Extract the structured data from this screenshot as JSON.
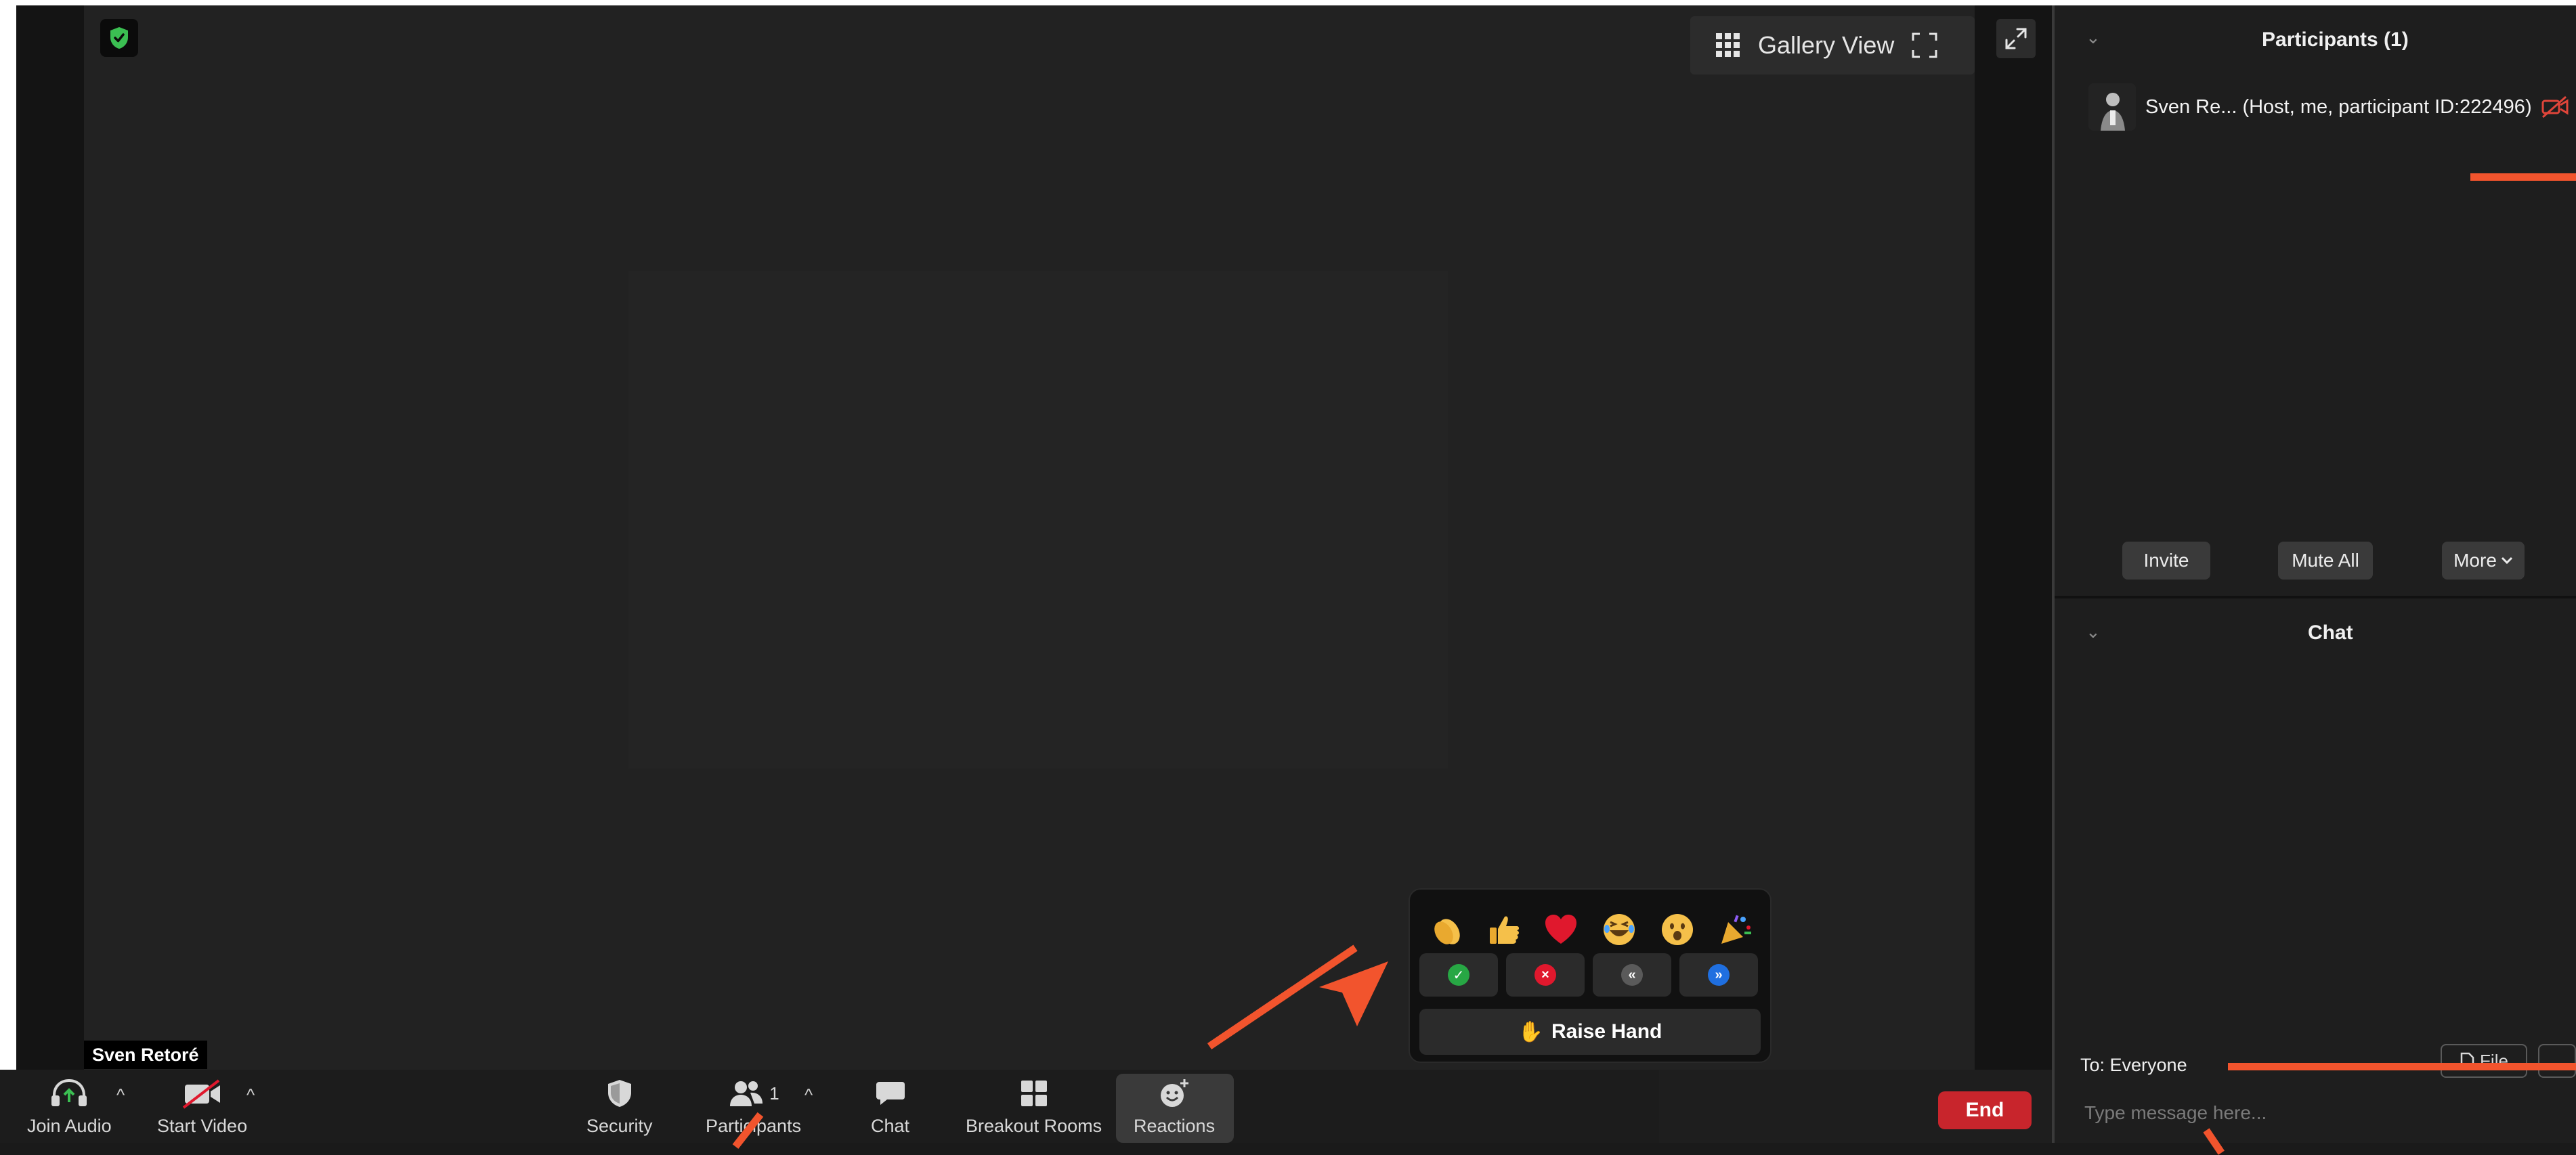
{
  "window": {
    "participant_name_tag": "Sven Retoré",
    "gallery_view_label": "Gallery View"
  },
  "toolbar": {
    "join_audio": "Join Audio",
    "start_video": "Start Video",
    "security": "Security",
    "participants": "Participants",
    "participants_count": "1",
    "chat": "Chat",
    "breakout_rooms": "Breakout Rooms",
    "reactions": "Reactions",
    "end": "End"
  },
  "reactions_popup": {
    "emojis": [
      "👏",
      "👍",
      "❤️",
      "😂",
      "😮",
      "🎉"
    ],
    "raise_hand_emoji": "✋",
    "raise_hand_label": "Raise Hand"
  },
  "participants_panel": {
    "title": "Participants (1)",
    "participant": "Sven Re... (Host, me, participant ID:222496)",
    "invite": "Invite",
    "mute_all": "Mute All",
    "more": "More"
  },
  "chat_panel": {
    "title": "Chat",
    "to": "To: Everyone",
    "file": "File",
    "input_placeholder": "Type message here..."
  },
  "colors": {
    "accent_annotation": "#f2542d",
    "end_button": "#c8252c",
    "secure_green": "#3bbf52"
  }
}
